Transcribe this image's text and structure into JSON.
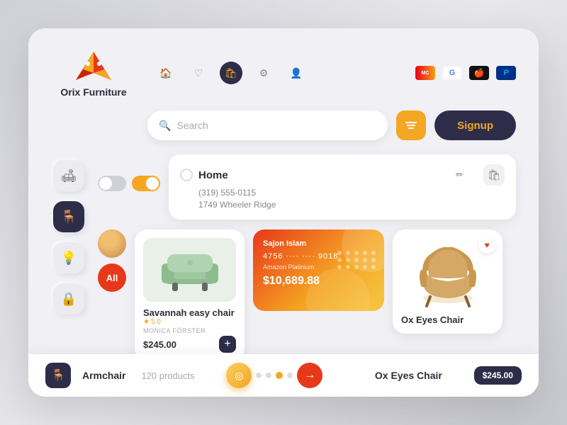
{
  "app": {
    "title": "Orix Furniture",
    "logo_emoji": "🦊"
  },
  "nav": {
    "home_icon": "🏠",
    "heart_icon": "♡",
    "bag_icon": "🛍",
    "settings_icon": "⚙",
    "user_icon": "👤"
  },
  "payment_brands": {
    "mastercard": "MC",
    "google": "G",
    "apple": "",
    "paypal": "P"
  },
  "search": {
    "placeholder": "Search",
    "filter_icon": "⚡",
    "signup_label": "Signup"
  },
  "sidebar": {
    "sofa_icon": "🛋",
    "lamp_icon": "💡",
    "lock_icon": "🔒"
  },
  "address": {
    "title": "Home",
    "phone": "(319) 555-0115",
    "street": "1749 Wheeler Ridge",
    "edit_icon": "✏"
  },
  "product1": {
    "name": "Savannah easy chair",
    "author": "MONICA FÖRSTER",
    "rating": "5.0",
    "price": "$245.00",
    "add_icon": "+"
  },
  "payment_card": {
    "holder": "Sajon Islam",
    "number": "4756 ···· ···· 9018",
    "type": "Amazon Platinium",
    "amount": "$10,689.88"
  },
  "product2": {
    "name": "Ox Eyes Chair",
    "price": "$245.00"
  },
  "bottom_bar": {
    "category": "Armchair",
    "count": "120 products",
    "arrow": "→"
  },
  "dots": [
    "",
    "",
    "",
    "",
    ""
  ],
  "active_dot": 0
}
